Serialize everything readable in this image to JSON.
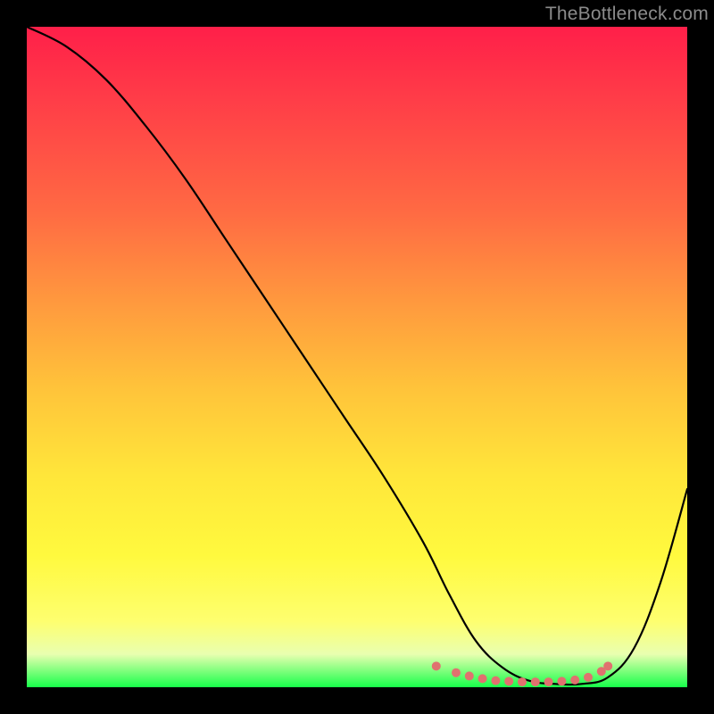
{
  "watermark": "TheBottleneck.com",
  "chart_data": {
    "type": "line",
    "title": "",
    "xlabel": "",
    "ylabel": "",
    "xlim": [
      0,
      100
    ],
    "ylim": [
      0,
      100
    ],
    "series": [
      {
        "name": "main-curve",
        "x": [
          0,
          6,
          12,
          18,
          24,
          30,
          36,
          42,
          48,
          54,
          60,
          64,
          68,
          72,
          76,
          80,
          84,
          88,
          92,
          96,
          100
        ],
        "y": [
          100,
          97,
          92,
          85,
          77,
          68,
          59,
          50,
          41,
          32,
          22,
          14,
          7,
          3,
          1,
          0.5,
          0.5,
          1.5,
          6,
          16,
          30
        ]
      }
    ],
    "markers": {
      "name": "bottom-dots",
      "color": "#e0716f",
      "x": [
        62,
        65,
        67,
        69,
        71,
        73,
        75,
        77,
        79,
        81,
        83,
        85,
        87,
        88
      ],
      "y": [
        3.2,
        2.2,
        1.7,
        1.3,
        1.0,
        0.9,
        0.8,
        0.8,
        0.8,
        0.9,
        1.1,
        1.5,
        2.4,
        3.2
      ]
    }
  }
}
